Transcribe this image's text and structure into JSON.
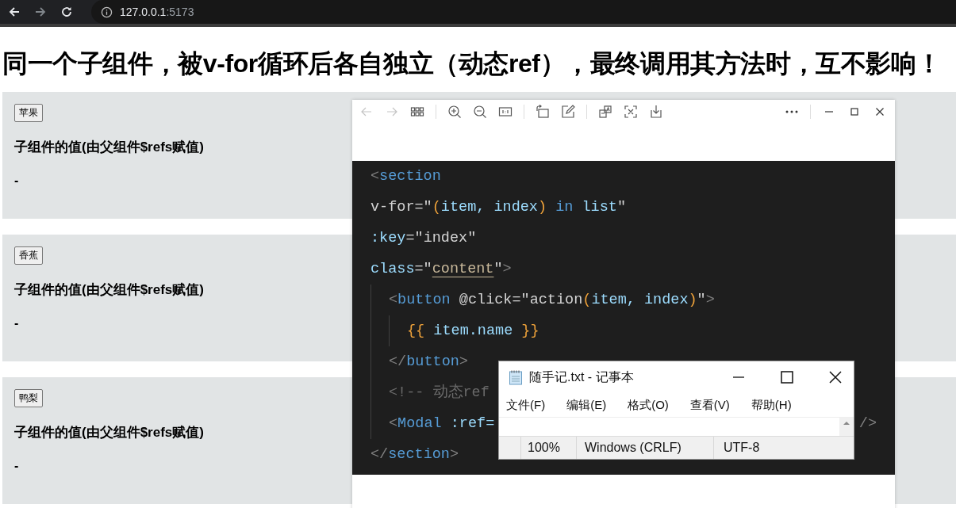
{
  "browser": {
    "back_disabled": false,
    "forward_disabled": true,
    "url_host": "127.0.0.1",
    "url_port": ":5173"
  },
  "heading": "同一个子组件，被v-for循环后各自独立（动态ref），最终调用其方法时，互不影响！",
  "cards": [
    {
      "button": "苹果",
      "label": "子组件的值(由父组件$refs赋值)",
      "value": "-"
    },
    {
      "button": "香蕉",
      "label": "子组件的值(由父组件$refs赋值)",
      "value": "-"
    },
    {
      "button": "鸭梨",
      "label": "子组件的值(由父组件$refs赋值)",
      "value": "-"
    }
  ],
  "viewer": {
    "toolbar": [
      {
        "kind": "back",
        "disabled": true
      },
      {
        "kind": "forward",
        "disabled": true
      },
      {
        "kind": "grid",
        "disabled": false
      },
      {
        "kind": "sep"
      },
      {
        "kind": "zoom-in",
        "disabled": false
      },
      {
        "kind": "zoom-out",
        "disabled": false
      },
      {
        "kind": "actual-size",
        "disabled": false
      },
      {
        "kind": "sep"
      },
      {
        "kind": "rotate",
        "disabled": false
      },
      {
        "kind": "edit",
        "disabled": false
      },
      {
        "kind": "sep"
      },
      {
        "kind": "translate",
        "disabled": false
      },
      {
        "kind": "scan",
        "disabled": false
      },
      {
        "kind": "download",
        "disabled": false
      }
    ],
    "code": [
      {
        "tokens": [
          {
            "kind": "punct",
            "text": "<"
          },
          {
            "kind": "tag",
            "text": "section"
          }
        ]
      },
      {
        "tokens": [
          {
            "kind": "text",
            "text": "v-for=\""
          },
          {
            "kind": "paren",
            "text": "("
          },
          {
            "kind": "var",
            "text": "item, index"
          },
          {
            "kind": "paren",
            "text": ")"
          },
          {
            "kind": "keyword",
            "text": " in "
          },
          {
            "kind": "var",
            "text": "list"
          },
          {
            "kind": "text",
            "text": "\""
          }
        ]
      },
      {
        "tokens": [
          {
            "kind": "attr",
            "text": ":key"
          },
          {
            "kind": "text",
            "text": "=\"index\""
          }
        ]
      },
      {
        "tokens": [
          {
            "kind": "attr",
            "text": "class"
          },
          {
            "kind": "text",
            "text": "=\""
          },
          {
            "kind": "link",
            "text": "content"
          },
          {
            "kind": "text",
            "text": "\""
          },
          {
            "kind": "punct",
            "text": ">"
          }
        ],
        "children": [
          {
            "tokens": [
              {
                "kind": "punct",
                "text": "<"
              },
              {
                "kind": "tag",
                "text": "button"
              },
              {
                "kind": "text",
                "text": " @click=\"action"
              },
              {
                "kind": "paren",
                "text": "("
              },
              {
                "kind": "var",
                "text": "item, index"
              },
              {
                "kind": "paren",
                "text": ")"
              },
              {
                "kind": "text",
                "text": "\""
              },
              {
                "kind": "punct",
                "text": ">"
              }
            ],
            "children": [
              {
                "tokens": [
                  {
                    "kind": "paren",
                    "text": "{{"
                  },
                  {
                    "kind": "var",
                    "text": " item.name "
                  },
                  {
                    "kind": "paren",
                    "text": "}}"
                  }
                ]
              }
            ]
          },
          {
            "tokens": [
              {
                "kind": "punct",
                "text": "</"
              },
              {
                "kind": "tag",
                "text": "button"
              },
              {
                "kind": "punct",
                "text": ">"
              }
            ]
          },
          {
            "tokens": [
              {
                "kind": "comment",
                "text": "<!-- 动态ref"
              }
            ]
          },
          {
            "tokens": [
              {
                "kind": "punct",
                "text": "<"
              },
              {
                "kind": "tag",
                "text": "Modal"
              },
              {
                "kind": "attr",
                "text": " :ref="
              }
            ],
            "tail": [
              {
                "kind": "punct",
                "text": "/>"
              }
            ]
          }
        ]
      },
      {
        "tokens": [
          {
            "kind": "punct",
            "text": "</"
          },
          {
            "kind": "tag",
            "text": "section"
          },
          {
            "kind": "punct",
            "text": ">"
          }
        ]
      }
    ]
  },
  "notepad": {
    "title": "随手记.txt - 记事本",
    "menu": [
      "文件(F)",
      "编辑(E)",
      "格式(O)",
      "查看(V)",
      "帮助(H)"
    ],
    "status": [
      "100%",
      "Windows (CRLF)",
      "UTF-8"
    ]
  }
}
